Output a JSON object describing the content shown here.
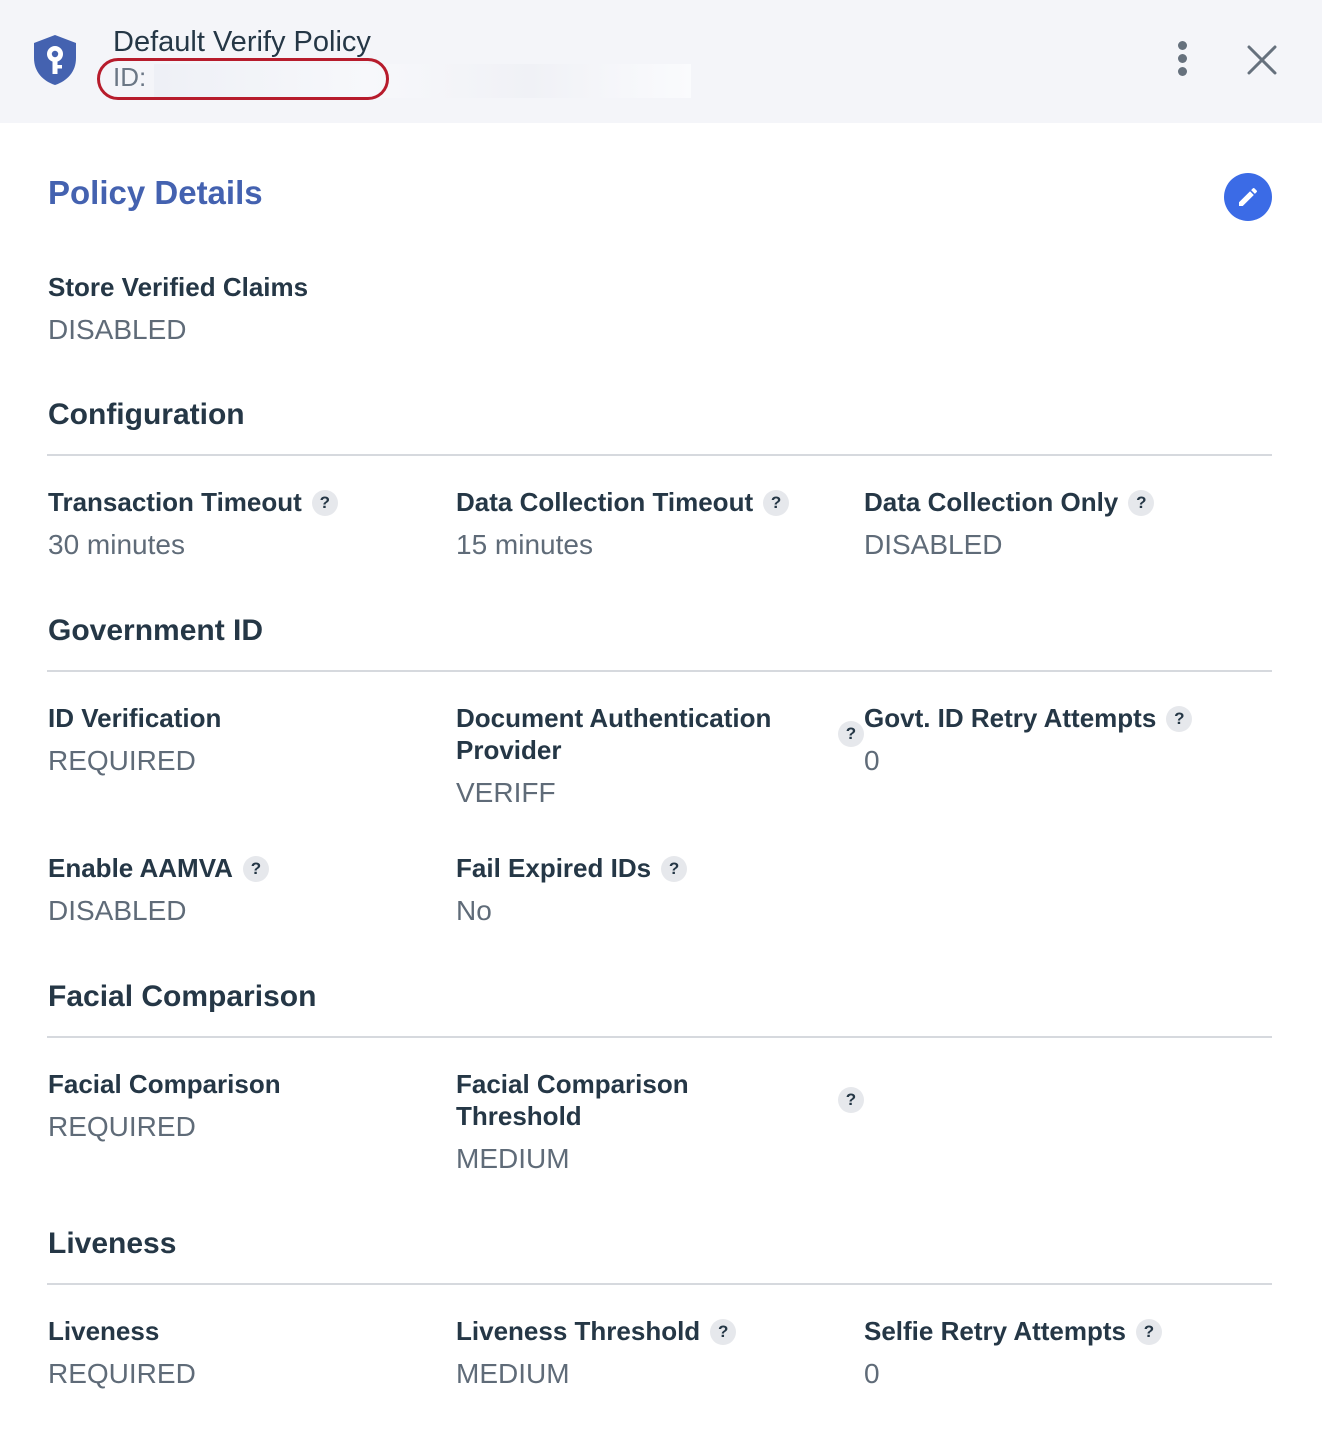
{
  "header": {
    "title": "Default Verify Policy",
    "id_label": "ID:",
    "icon": "shield-key-icon",
    "more_icon": "kebab-menu-icon",
    "close_icon": "close-icon"
  },
  "details": {
    "title": "Policy Details",
    "edit_icon": "pencil-icon",
    "store_verified_claims": {
      "label": "Store Verified Claims",
      "value": "DISABLED"
    }
  },
  "help_glyph": "?",
  "configuration": {
    "heading": "Configuration",
    "fields": [
      {
        "label": "Transaction Timeout",
        "value": "30 minutes"
      },
      {
        "label": "Data Collection Timeout",
        "value": "15 minutes"
      },
      {
        "label": "Data Collection Only",
        "value": "DISABLED"
      }
    ]
  },
  "government_id": {
    "heading": "Government ID",
    "fields": [
      {
        "label": "ID Verification",
        "value": "REQUIRED"
      },
      {
        "label": "Document Authentication Provider",
        "value": "VERIFF"
      },
      {
        "label": "Govt. ID Retry Attempts",
        "value": "0"
      },
      {
        "label": "Enable AAMVA",
        "value": "DISABLED"
      },
      {
        "label": "Fail Expired IDs",
        "value": "No"
      }
    ]
  },
  "facial_comparison": {
    "heading": "Facial Comparison",
    "fields": [
      {
        "label": "Facial Comparison",
        "value": "REQUIRED"
      },
      {
        "label": "Facial Comparison Threshold",
        "value": "MEDIUM"
      }
    ]
  },
  "liveness": {
    "heading": "Liveness",
    "fields": [
      {
        "label": "Liveness",
        "value": "REQUIRED"
      },
      {
        "label": "Liveness Threshold",
        "value": "MEDIUM"
      },
      {
        "label": "Selfie Retry Attempts",
        "value": "0"
      }
    ]
  },
  "colors": {
    "accent": "#4462b0",
    "edit_button": "#3b6be6",
    "header_bg": "#f4f5f9",
    "annotation_oval": "#b71c2c"
  }
}
